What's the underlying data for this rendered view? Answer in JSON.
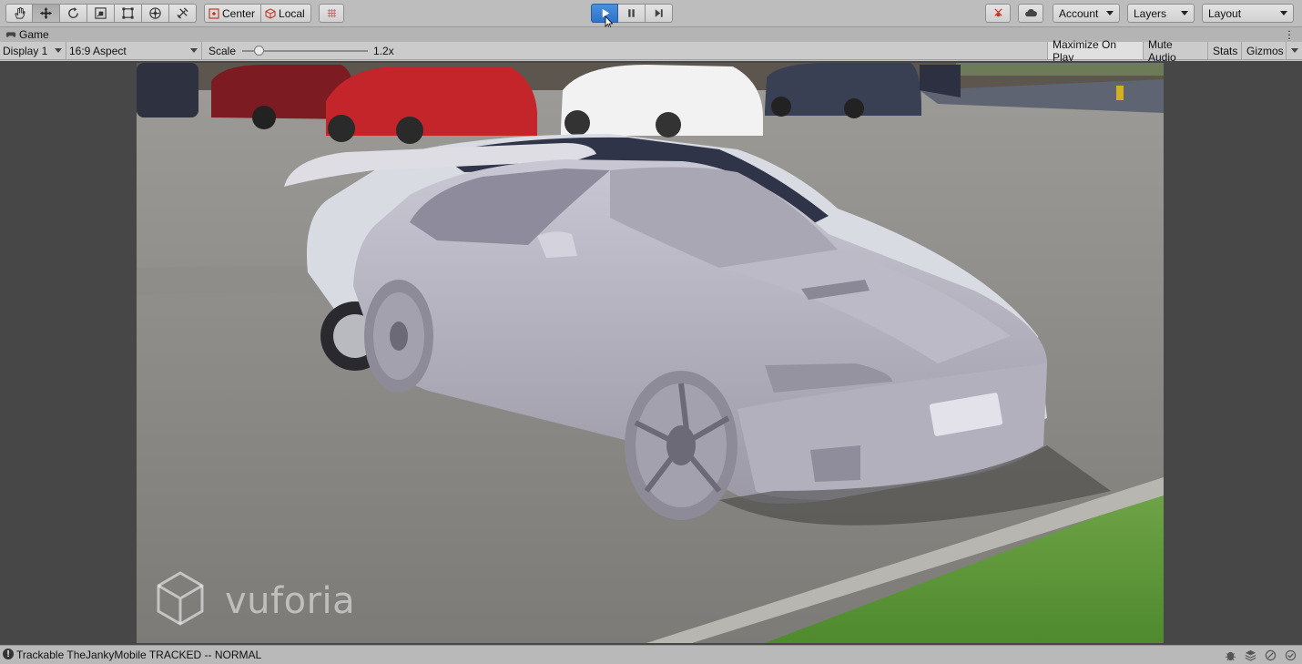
{
  "toolbar": {
    "transform_tools": [
      {
        "name": "hand-tool-icon"
      },
      {
        "name": "move-tool-icon"
      },
      {
        "name": "rotate-tool-icon"
      },
      {
        "name": "scale-tool-icon"
      },
      {
        "name": "rect-tool-icon"
      },
      {
        "name": "transform-tool-icon"
      },
      {
        "name": "custom-tool-icon"
      }
    ],
    "pivot_mode": "Center",
    "pivot_rotation": "Local",
    "play_state": "playing",
    "account_label": "Account",
    "layers_label": "Layers",
    "layout_label": "Layout"
  },
  "game_tab": {
    "label": "Game"
  },
  "game_view": {
    "display": "Display 1",
    "aspect": "16:9 Aspect",
    "scale_label": "Scale",
    "scale_value": "1.2x",
    "scale_fraction": 0.1,
    "toggles": [
      "Maximize On Play",
      "Mute Audio",
      "Stats",
      "Gizmos"
    ],
    "maximize_on_play": true
  },
  "scene": {
    "watermark": "vuforia"
  },
  "status": {
    "message": "Trackable TheJankyMobile TRACKED -- NORMAL"
  },
  "colors": {
    "play_button": "#2f73c6",
    "toolbar_bg": "#bdbdbd",
    "viewport_bg": "#474747"
  }
}
